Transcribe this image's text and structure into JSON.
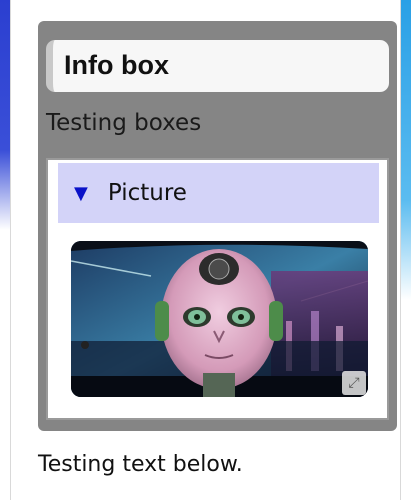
{
  "infobox": {
    "title": "Info box",
    "subtitle": "Testing boxes"
  },
  "details": {
    "summary_label": "Picture",
    "expanded_icon": "triangle-down-icon"
  },
  "image": {
    "subject": "robot-head-city-night",
    "expand_icon": "expand-icon"
  },
  "footer": {
    "text": "Testing text below."
  },
  "colors": {
    "infobox_bg": "#858585",
    "summary_bg": "#d3d3f8",
    "triangle": "#0a12c8",
    "page_accent_left": "#2b3fd0",
    "page_accent_right": "#2aa0e6"
  }
}
